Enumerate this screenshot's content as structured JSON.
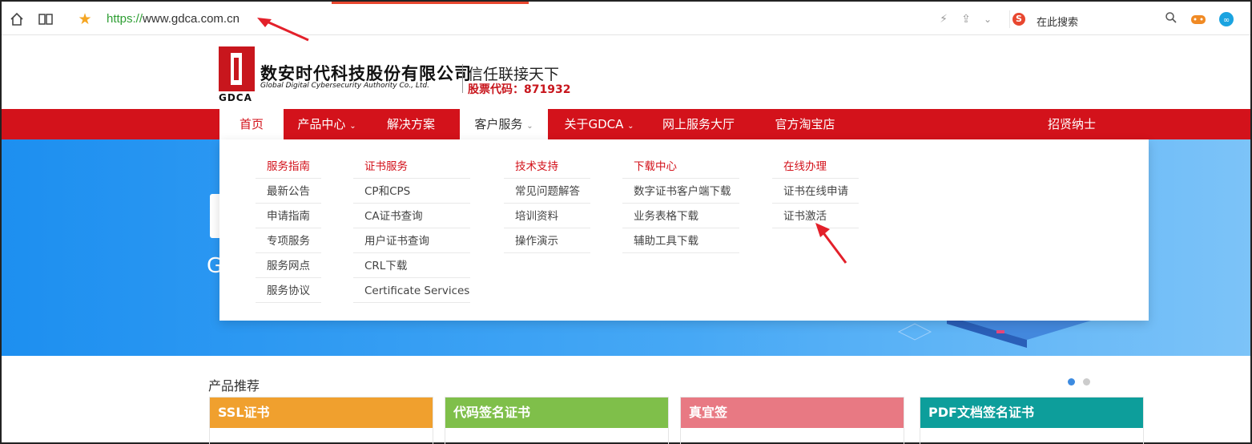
{
  "browser": {
    "url_scheme": "https://",
    "url_host": "www.gdca.com.cn",
    "search_placeholder": "在此搜索",
    "icons": [
      "home-icon",
      "reader-icon",
      "star-icon",
      "bolt-icon",
      "share-icon",
      "chevron-down-icon",
      "sogou-icon",
      "search-icon",
      "game-icon",
      "extension-icon"
    ]
  },
  "header": {
    "logo_text": "GDCA",
    "company_cn": "数安时代科技股份有限公司",
    "company_en": "Global Digital Cybersecurity Authority Co., Ltd.",
    "slogan": "信任联接天下",
    "stock": "股票代码：871932"
  },
  "nav": {
    "items": [
      {
        "label": "首页"
      },
      {
        "label": "产品中心"
      },
      {
        "label": "解决方案"
      },
      {
        "label": "客户服务"
      },
      {
        "label": "关于GDCA"
      },
      {
        "label": "网上服务大厅"
      },
      {
        "label": "官方淘宝店"
      },
      {
        "label": "招贤纳士"
      }
    ]
  },
  "dropdown": {
    "columns": [
      {
        "head": "服务指南",
        "items": [
          "最新公告",
          "申请指南",
          "专项服务",
          "服务网点",
          "服务协议"
        ]
      },
      {
        "head": "证书服务",
        "items": [
          "CP和CPS",
          "CA证书查询",
          "用户证书查询",
          "CRL下载",
          "Certificate Services"
        ]
      },
      {
        "head": "技术支持",
        "items": [
          "常见问题解答",
          "培训资料",
          "操作演示"
        ]
      },
      {
        "head": "下载中心",
        "items": [
          "数字证书客户端下载",
          "业务表格下载",
          "辅助工具下载"
        ]
      },
      {
        "head": "在线办理",
        "items": [
          "证书在线申请",
          "证书激活"
        ]
      }
    ]
  },
  "products": {
    "title": "产品推荐",
    "cards": [
      {
        "label": "SSL证书",
        "color": "#f0a02e"
      },
      {
        "label": "代码签名证书",
        "color": "#7fbf4a"
      },
      {
        "label": "真宜签",
        "color": "#e87983"
      },
      {
        "label": "PDF文档签名证书",
        "color": "#0d9e9b"
      }
    ]
  },
  "colors": {
    "brand_red": "#d3121b",
    "banner_blue": "#2d9bf2",
    "annotation_red": "#e3202a"
  }
}
